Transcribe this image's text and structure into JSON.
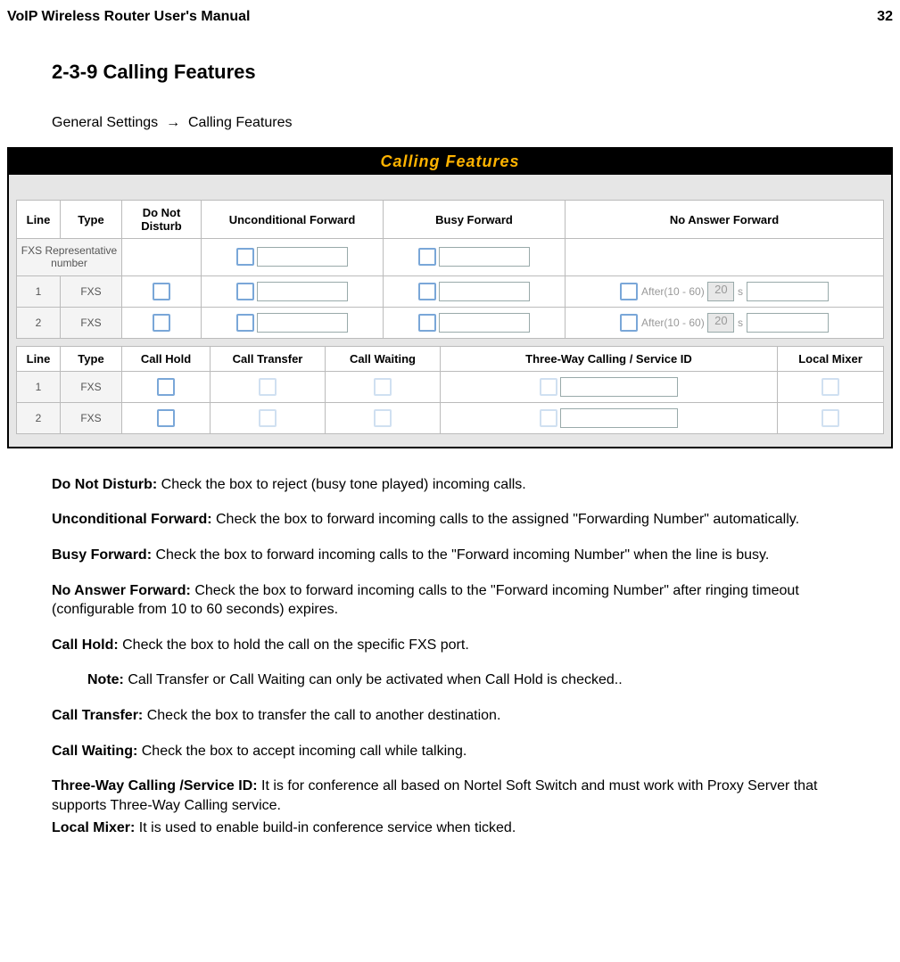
{
  "header": {
    "left": "VoIP Wireless Router User's Manual",
    "right": "32"
  },
  "section_title": "2-3-9 Calling Features",
  "breadcrumb": {
    "a": "General Settings",
    "sep": "→",
    "b": "Calling Features"
  },
  "panel_title": "Calling  Features",
  "table1": {
    "headers": {
      "line": "Line",
      "type": "Type",
      "dnd": "Do Not Disturb",
      "uf": "Unconditional Forward",
      "bf": "Busy Forward",
      "naf": "No Answer Forward"
    },
    "rep_label": "FXS Representative number",
    "after_label": "After(10 - 60)",
    "after_default": "20",
    "after_unit": "s",
    "rows": [
      {
        "line": "1",
        "type": "FXS"
      },
      {
        "line": "2",
        "type": "FXS"
      }
    ]
  },
  "table2": {
    "headers": {
      "line": "Line",
      "type": "Type",
      "ch": "Call Hold",
      "ct": "Call Transfer",
      "cw": "Call Waiting",
      "tw": "Three-Way Calling / Service ID",
      "lm": "Local Mixer"
    },
    "rows": [
      {
        "line": "1",
        "type": "FXS"
      },
      {
        "line": "2",
        "type": "FXS"
      }
    ]
  },
  "desc": {
    "dnd_b": "Do Not Disturb:",
    "dnd_t": " Check the box to reject (busy tone played) incoming calls.",
    "uf_b": "Unconditional Forward:",
    "uf_t": " Check the box to forward incoming calls to the assigned \"Forwarding Number\" automatically.",
    "bf_b": "Busy Forward:",
    "bf_t": " Check the box to forward incoming calls to the \"Forward incoming Number\" when the line is busy.",
    "naf_b": "No Answer Forward:",
    "naf_t": " Check the box to forward incoming calls to the \"Forward incoming Number\" after ringing timeout (configurable from 10 to 60 seconds) expires.",
    "ch_b": "Call Hold:",
    "ch_t": " Check the box to hold the call on the specific FXS port.",
    "note_b": "Note:",
    "note_t": " Call Transfer or Call Waiting can only be activated when Call Hold is checked..",
    "ct_b": "Call Transfer:",
    "ct_t": " Check the box to transfer the call to another destination.",
    "cw_b": "Call Waiting:",
    "cw_t": " Check the box to accept incoming call while talking.",
    "tw_b": "Three-Way Calling /Service ID:",
    "tw_t": " It is for conference all based on Nortel Soft Switch and must work with Proxy Server that supports Three-Way Calling service.",
    "lm_b": "Local Mixer:",
    "lm_t": " It is used to enable build-in conference service when ticked."
  }
}
